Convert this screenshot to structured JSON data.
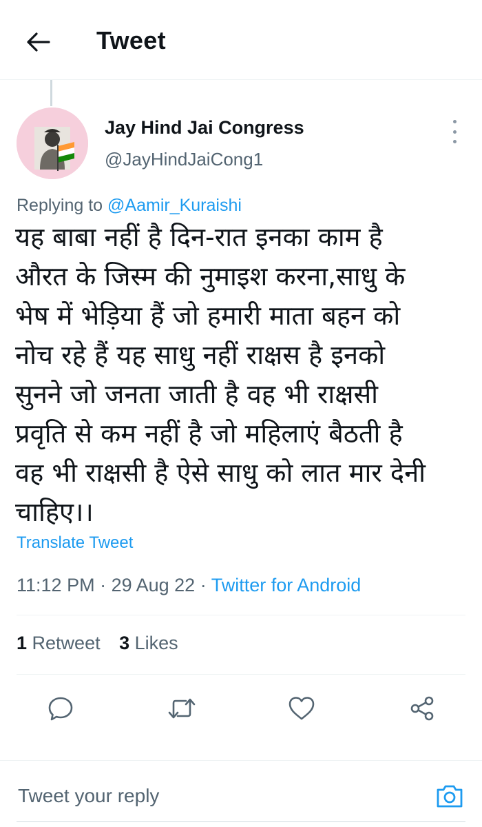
{
  "header": {
    "title": "Tweet",
    "back_icon": "arrow-left-icon"
  },
  "author": {
    "name": "Jay Hind Jai Congress",
    "handle": "@JayHindJaiCong1",
    "avatar_icon": "profile-avatar",
    "more_icon": "more-vertical-icon"
  },
  "reply_context": {
    "prefix": "Replying to ",
    "mention": "@Aamir_Kuraishi"
  },
  "tweet": {
    "lines": [
      "यह बाबा नहीं है दिन-रात इनका काम है",
      "औरत के जिस्म की नुमाइश करना,साधु के",
      "भेष में भेड़िया हैं जो हमारी माता बहन को",
      "नोच रहे हैं यह साधु नहीं राक्षस है इनको",
      "सुनने जो जनता जाती है वह भी राक्षसी",
      "प्रवृति से कम नहीं है जो महिलाएं बैठती है",
      "वह भी राक्षसी है ऐसे साधु को लात मार देनी",
      "चाहिए।।"
    ],
    "translate_label": "Translate Tweet",
    "time": "11:12 PM",
    "separator": " · ",
    "date": "29 Aug 22",
    "source": "Twitter for Android"
  },
  "stats": {
    "retweets_count": "1",
    "retweets_label": " Retweet",
    "likes_count": "3",
    "likes_label": " Likes"
  },
  "actions": [
    {
      "name": "reply",
      "icon": "reply-bubble-icon"
    },
    {
      "name": "retweet",
      "icon": "retweet-icon"
    },
    {
      "name": "like",
      "icon": "heart-icon"
    },
    {
      "name": "share",
      "icon": "share-icon"
    }
  ],
  "reply_bar": {
    "placeholder": "Tweet your reply",
    "camera_icon": "camera-icon"
  },
  "colors": {
    "accent": "#1d9bf0",
    "text_secondary": "#536471",
    "divider": "#eff3f4"
  }
}
